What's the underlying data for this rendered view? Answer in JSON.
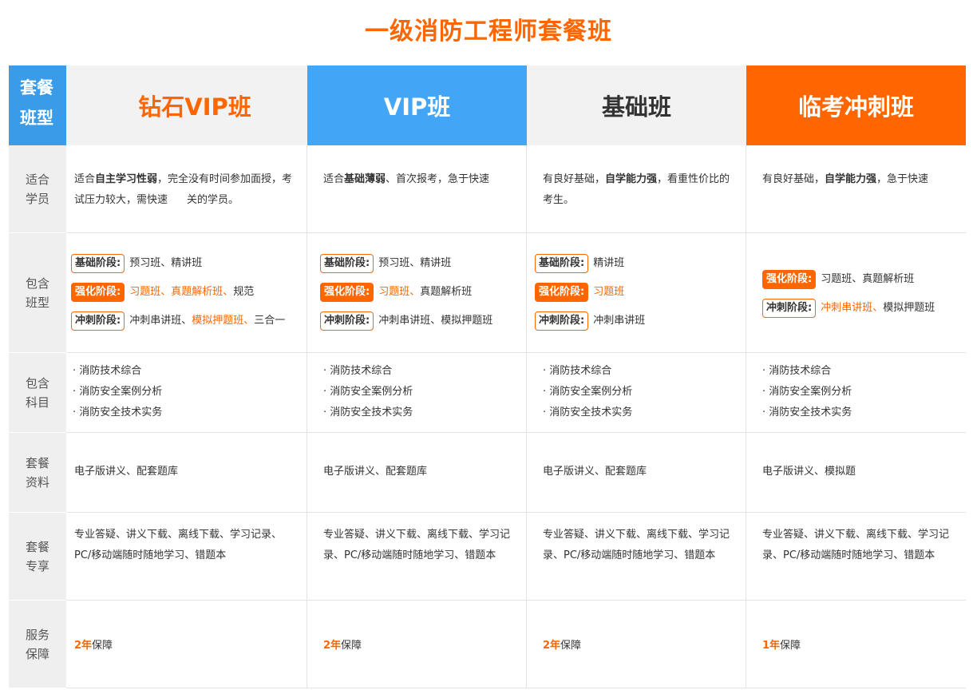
{
  "title": "一级消防工程师套餐班",
  "header": {
    "label_line1": "套餐",
    "label_line2": "班型",
    "plans": [
      "钻石VIP班",
      "VIP班",
      "基础班",
      "临考冲刺班"
    ]
  },
  "colors": {
    "orange": "#ff6600",
    "blue": "#42a5f5",
    "label_blue": "#3a9ce8",
    "gray_bg": "#f2f2f2"
  },
  "rows": {
    "suitable": {
      "label1": "适合",
      "label2": "学员",
      "c1": {
        "a": "适合",
        "b": "自主学习性弱",
        "c": "，完全没有时间参加面授，考试压力较大，需快速",
        "d": "关的学员。"
      },
      "c2": {
        "a": "适合",
        "b": "基础薄弱",
        "c": "、首次报考，急于快速"
      },
      "c3": {
        "a": "有良好基础，",
        "b": "自学能力强",
        "c": "，看重性价比的考生。"
      },
      "c4": {
        "a": "有良好基础，",
        "b": "自学能力强",
        "c": "，急于快速"
      }
    },
    "classes": {
      "label1": "包含",
      "label2": "班型",
      "tags": {
        "basic": "基础阶段:",
        "strong": "强化阶段:",
        "sprint": "冲刺阶段:"
      },
      "c1": {
        "basic": "预习班、精讲班",
        "strong_hl": "习题班、真题解析班、",
        "strong_rest": "规范",
        "sprint_a": "冲刺串讲班、",
        "sprint_hl": "模拟押题班、",
        "sprint_b": "三合一"
      },
      "c2": {
        "basic": "预习班、精讲班",
        "strong_hl": "习题班、",
        "strong_rest": "真题解析班",
        "sprint": "冲刺串讲班、模拟押题班"
      },
      "c3": {
        "basic": "精讲班",
        "strong_hl": "习题班",
        "sprint": "冲刺串讲班"
      },
      "c4": {
        "strong": "习题班、真题解析班",
        "sprint_hl": "冲刺串讲班、",
        "sprint_rest": "模拟押题班"
      }
    },
    "subjects": {
      "label1": "包含",
      "label2": "科目",
      "items": [
        "· 消防技术综合",
        "· 消防安全案例分析",
        "· 消防安全技术实务"
      ]
    },
    "materials": {
      "label1": "套餐",
      "label2": "资料",
      "c1": "电子版讲义、配套题库",
      "c2": "电子版讲义、配套题库",
      "c3": "电子版讲义、配套题库",
      "c4": "电子版讲义、模拟题"
    },
    "exclusive": {
      "label1": "套餐",
      "label2": "专享",
      "c1": "专业答疑、讲义下载、离线下载、学习记录、PC/移动端随时随地学习、错题本",
      "c2": "专业答疑、讲义下载、离线下载、学习记录、PC/移动端随时随地学习、错题本",
      "c3": "专业答疑、讲义下载、离线下载、学习记录、PC/移动端随时随地学习、错题本",
      "c4": "专业答疑、讲义下载、离线下载、学习记录、PC/移动端随时随地学习、错题本"
    },
    "guarantee": {
      "label1": "服务",
      "label2": "保障",
      "c1_year": "2年",
      "c2_year": "2年",
      "c3_year": "2年",
      "c4_year": "1年",
      "suffix": "保障"
    }
  }
}
